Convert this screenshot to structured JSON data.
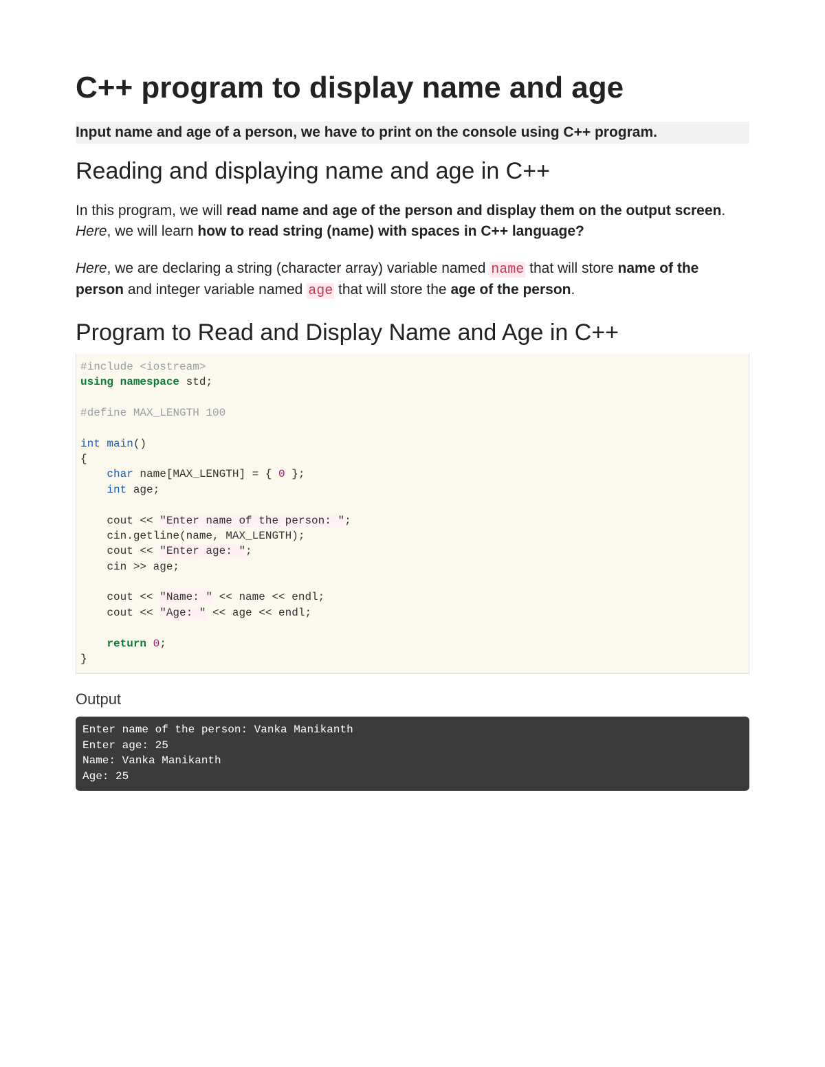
{
  "title": "C++ program to display name and age",
  "subtitle": "Input name and age of a person, we have to print on the console using C++ program.",
  "heading1": "Reading and displaying name and age in C++",
  "para1": {
    "t1": "In this program, we will ",
    "b1": "read name and age of the person and display them on the output screen",
    "t2": ". ",
    "i1": "Here",
    "t3": ", we will learn ",
    "b2": "how to read string (name) with spaces in C++ language?"
  },
  "para2": {
    "i1": "Here",
    "t1": ", we are declaring a string (character array) variable named ",
    "c1": "name",
    "t2": " that will store ",
    "b1": "name of the person",
    "t3": " and integer variable named ",
    "c2": "age",
    "t4": " that will store the ",
    "b2": "age of the person",
    "t5": "."
  },
  "heading2": "Program to Read and Display Name and Age in C++",
  "code": {
    "l01a": "#include <iostream>",
    "l02a": "using",
    "l02b": " namespace",
    "l02c": " std;",
    "l03": "",
    "l04a": "#define MAX_LENGTH 100",
    "l05": "",
    "l06a": "int",
    "l06b": " main",
    "l06c": "()",
    "l07": "{",
    "l08a": "    ",
    "l08b": "char",
    "l08c": " name[MAX_LENGTH] = { ",
    "l08d": "0",
    "l08e": " };",
    "l09a": "    ",
    "l09b": "int",
    "l09c": " age;",
    "l10": "",
    "l11a": "    cout << ",
    "l11b": "\"Enter name of the person: \"",
    "l11c": ";",
    "l12a": "    cin.getline(name, MAX_LENGTH);",
    "l13a": "    cout << ",
    "l13b": "\"Enter age: \"",
    "l13c": ";",
    "l14a": "    cin >> age;",
    "l15": "",
    "l16a": "    cout << ",
    "l16b": "\"Name: \"",
    "l16c": " << name << endl;",
    "l17a": "    cout << ",
    "l17b": "\"Age: \"",
    "l17c": " << age << endl;",
    "l18": "",
    "l19a": "    ",
    "l19b": "return",
    "l19c": " ",
    "l19d": "0",
    "l19e": ";",
    "l20": "}"
  },
  "output_label": "Output",
  "output": {
    "l1": "Enter name of the person: Vanka Manikanth",
    "l2": "Enter age: 25",
    "l3": "Name: Vanka Manikanth",
    "l4": "Age: 25"
  }
}
